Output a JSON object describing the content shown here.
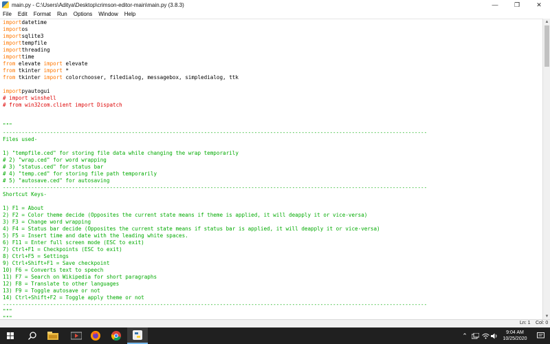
{
  "window": {
    "title": "main.py - C:\\Users\\Aditya\\Desktop\\crimson-editor-main\\main.py (3.8.3)",
    "minimize_icon": "minimize-icon",
    "maximize_icon": "restore-icon",
    "close_icon": "close-icon"
  },
  "menu": [
    "File",
    "Edit",
    "Format",
    "Run",
    "Options",
    "Window",
    "Help"
  ],
  "colors": {
    "keyword": "#ff7700",
    "comment": "#dd0000",
    "string": "#00aa00",
    "taskbar": "#202020"
  },
  "code_lines": [
    [
      [
        "kw",
        "import"
      ],
      [
        "",
        "datetime"
      ]
    ],
    [
      [
        "kw",
        "import"
      ],
      [
        "",
        "os"
      ]
    ],
    [
      [
        "kw",
        "import"
      ],
      [
        "",
        "sqlite3"
      ]
    ],
    [
      [
        "kw",
        "import"
      ],
      [
        "",
        "tempfile"
      ]
    ],
    [
      [
        "kw",
        "import"
      ],
      [
        "",
        "threading"
      ]
    ],
    [
      [
        "kw",
        "import"
      ],
      [
        "",
        "time"
      ]
    ],
    [
      [
        "kw",
        "from"
      ],
      [
        "",
        " elevate "
      ],
      [
        "kw",
        "import"
      ],
      [
        "",
        " elevate"
      ]
    ],
    [
      [
        "kw",
        "from"
      ],
      [
        "",
        " tkinter "
      ],
      [
        "kw",
        "import"
      ],
      [
        "",
        " *"
      ]
    ],
    [
      [
        "kw",
        "from"
      ],
      [
        "",
        " tkinter "
      ],
      [
        "kw",
        "import"
      ],
      [
        "",
        " colorchooser, filedialog, messagebox, simpledialog, ttk"
      ]
    ],
    [],
    [
      [
        "kw",
        "import"
      ],
      [
        "",
        "pyautogui"
      ]
    ],
    [
      [
        "cm",
        "# import winshell"
      ]
    ],
    [
      [
        "cm",
        "# from win32com.client import Dispatch"
      ]
    ],
    [],
    [],
    [
      [
        "st",
        "\"\"\""
      ]
    ],
    [
      [
        "st",
        "---------------------------------------------------------------------------------------------------------------------------------------"
      ]
    ],
    [
      [
        "st",
        "Files used-"
      ]
    ],
    [],
    [
      [
        "st",
        "1) \"tempfile.ced\" for storing file data while changing the wrap temporarily"
      ]
    ],
    [
      [
        "st",
        "# 2) \"wrap.ced\" for word wrapping"
      ]
    ],
    [
      [
        "st",
        "# 3) \"status.ced\" for status bar"
      ]
    ],
    [
      [
        "st",
        "# 4) \"temp.ced\" for storing file path temporarily"
      ]
    ],
    [
      [
        "st",
        "# 5) \"autosave.ced\" for autosaving"
      ]
    ],
    [
      [
        "st",
        "---------------------------------------------------------------------------------------------------------------------------------------"
      ]
    ],
    [
      [
        "st",
        "Shortcut Keys-"
      ]
    ],
    [],
    [
      [
        "st",
        "1) F1 = About"
      ]
    ],
    [
      [
        "st",
        "2) F2 = Color theme decide (Opposites the current state means if theme is applied, it will deapply it or vice-versa)"
      ]
    ],
    [
      [
        "st",
        "3) F3 = Change word wrapping"
      ]
    ],
    [
      [
        "st",
        "4) F4 = Status bar decide (Opposites the current state means if status bar is applied, it will deapply it or vice-versa)"
      ]
    ],
    [
      [
        "st",
        "5) F5 = Insert time and date with the leading white spaces."
      ]
    ],
    [
      [
        "st",
        "6) F11 = Enter full screen mode (ESC to exit)"
      ]
    ],
    [
      [
        "st",
        "7) Ctrl+F1 = Checkpoints (ESC to exit)"
      ]
    ],
    [
      [
        "st",
        "8) Ctrl+F5 = Settings"
      ]
    ],
    [
      [
        "st",
        "9) Ctrl+Shift+F1 = Save checkpoint"
      ]
    ],
    [
      [
        "st",
        "10) F6 = Converts text to speech"
      ]
    ],
    [
      [
        "st",
        "11) F7 = Search on Wikipedia for short paragraphs"
      ]
    ],
    [
      [
        "st",
        "12) F8 = Translate to other languages"
      ]
    ],
    [
      [
        "st",
        "13) F9 = Toggle autosave or not"
      ]
    ],
    [
      [
        "st",
        "14) Ctrl+Shift+F2 = Toggle apply theme or not"
      ]
    ],
    [
      [
        "st",
        "---------------------------------------------------------------------------------------------------------------------------------------"
      ]
    ],
    [
      [
        "st",
        "\"\"\""
      ]
    ],
    [
      [
        "st",
        "\"\"\""
      ]
    ]
  ],
  "status": {
    "line": "Ln: 1",
    "col": "Col: 0"
  },
  "taskbar": {
    "icons": [
      "windows-start-icon",
      "search-icon",
      "task-view-icon",
      "file-explorer-icon",
      "media-player-icon",
      "firefox-icon",
      "chrome-icon",
      "python-idle-icon"
    ],
    "tray_icons": [
      "chevron-up-icon",
      "network-icon",
      "volume-icon",
      "keyboard-icon",
      "notification-icon"
    ],
    "time": "9:04 AM",
    "date": "10/25/2020"
  }
}
